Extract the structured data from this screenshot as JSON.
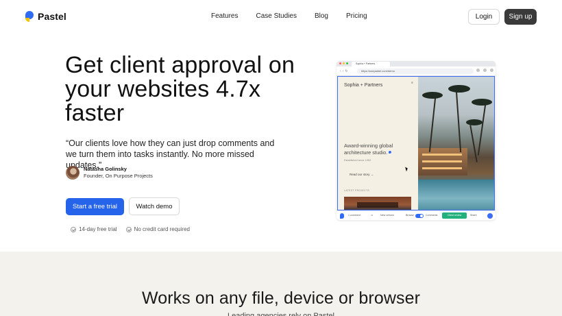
{
  "nav": {
    "logo_text": "Pastel",
    "links": [
      "Features",
      "Case Studies",
      "Blog",
      "Pricing"
    ],
    "login_label": "Login",
    "signup_label": "Sign up"
  },
  "hero": {
    "headline": "Get client approval on your websites 4.7x faster",
    "quote": "“Our clients love how they can just drop comments and we turn them into tasks instantly. No more missed updates.”",
    "author_name": "Natasha Golinsky",
    "author_role": "Founder, On Purpose Projects",
    "primary_cta": "Start a free trial",
    "secondary_cta": "Watch demo",
    "perks": [
      "14-day free trial",
      "No credit card required"
    ]
  },
  "browser_mock": {
    "tab_title": "Sophia + Partners",
    "url": "https://usepastel.com/demo",
    "site_brand": "Sophia + Partners",
    "site_tagline": "Award-winning global architecture studio.",
    "site_established": "Established since 1992",
    "site_read_link": "Read our story →",
    "site_latest_label": "LATEST PROJECTS",
    "toolbar": {
      "comments_count": "1 comment",
      "new_version": "New version",
      "browse": "Browse",
      "comments": "Comments",
      "green_action": "Client review",
      "share": "Share"
    },
    "colors": {
      "selection_border": "#3b6ef5",
      "green_button": "#22b07d"
    }
  },
  "section2": {
    "title": "Works on any file, device or browser",
    "subtitle": "Leading agencies rely on Pastel"
  },
  "colors": {
    "primary": "#2563eb",
    "signup_bg": "#3a3a3a",
    "section_bg": "#f4f2ec"
  }
}
